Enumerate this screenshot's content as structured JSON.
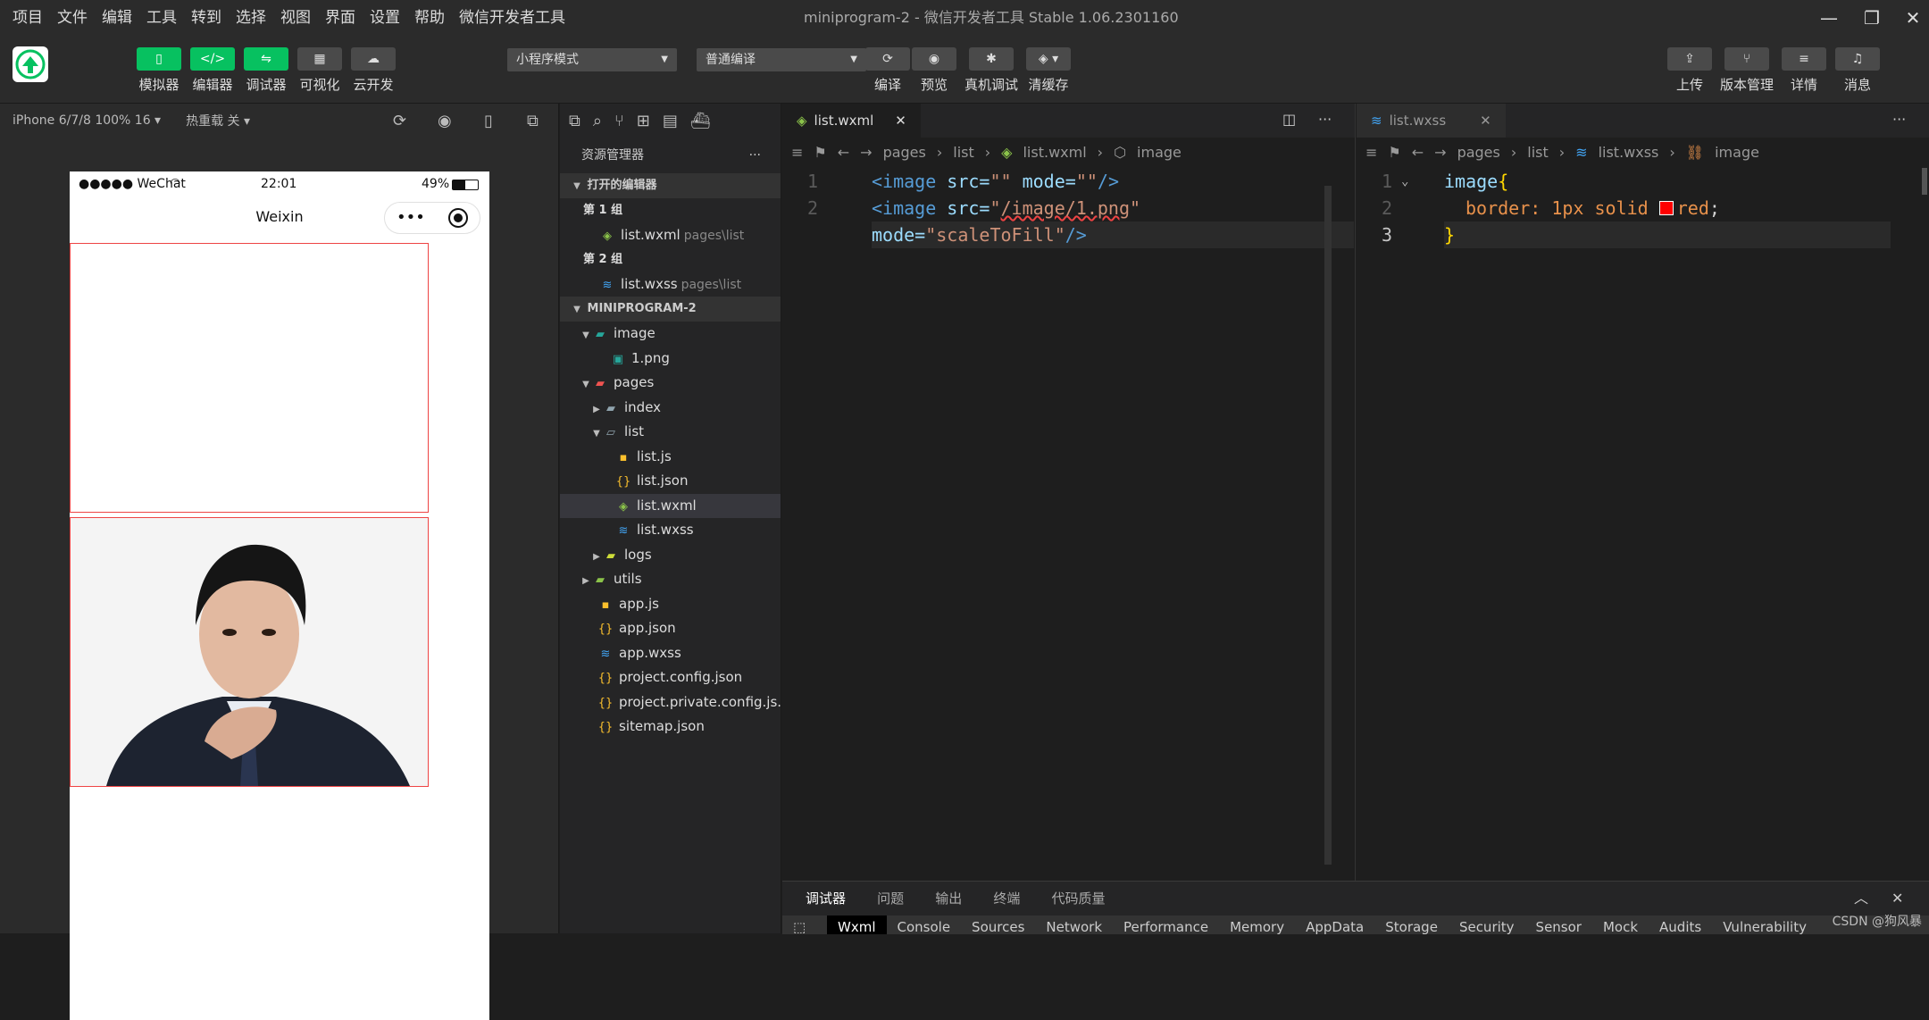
{
  "menubar": {
    "items": [
      "项目",
      "文件",
      "编辑",
      "工具",
      "转到",
      "选择",
      "视图",
      "界面",
      "设置",
      "帮助",
      "微信开发者工具"
    ],
    "title": "miniprogram-2 - 微信开发者工具 Stable 1.06.2301160"
  },
  "toolbar": {
    "left_buttons": [
      "模拟器",
      "编辑器",
      "调试器",
      "可视化",
      "云开发"
    ],
    "mode_select": "小程序模式",
    "compile_select": "普通编译",
    "mid_buttons": [
      "编译",
      "预览",
      "真机调试",
      "清缓存"
    ],
    "right_buttons": [
      "上传",
      "版本管理",
      "详情",
      "消息"
    ]
  },
  "simulator": {
    "device": "iPhone 6/7/8 100% 16",
    "hot_reload": "热重载 关",
    "status": {
      "carrier": "●●●●● WeChat",
      "time": "22:01",
      "battery": "49%"
    },
    "nav_title": "Weixin",
    "capsule_dots": "•••"
  },
  "explorer": {
    "title": "资源管理器",
    "open_editors_section": "打开的编辑器",
    "group1": "第 1 组",
    "group1_file": "list.wxml",
    "group1_path": "pages\\list",
    "group2": "第 2 组",
    "group2_file": "list.wxss",
    "group2_path": "pages\\list",
    "project_section": "MINIPROGRAM-2",
    "tree": {
      "image": "image",
      "image_1": "1.png",
      "pages": "pages",
      "index": "index",
      "list": "list",
      "list_js": "list.js",
      "list_json": "list.json",
      "list_wxml": "list.wxml",
      "list_wxss": "list.wxss",
      "logs": "logs",
      "utils": "utils",
      "app_js": "app.js",
      "app_json": "app.json",
      "app_wxss": "app.wxss",
      "project_config": "project.config.json",
      "project_private": "project.private.config.js...",
      "sitemap": "sitemap.json"
    }
  },
  "editor1": {
    "tab": "list.wxml",
    "crumbs": [
      "pages",
      "list",
      "list.wxml",
      "image"
    ],
    "line_numbers": [
      "1",
      "2"
    ],
    "l1": {
      "open": "<image",
      "attr1": " src=",
      "v1": "\"\"",
      "attr2": " mode=",
      "v2": "\"\"",
      "close": "/>"
    },
    "l2a": {
      "open": "<image",
      "attr1": " src=",
      "q1": "\"",
      "v1": "/image/1.png",
      "q2": "\""
    },
    "l2b": {
      "attr": "mode=",
      "v": "\"scaleToFill\"",
      "close": "/>"
    }
  },
  "editor2": {
    "tab": "list.wxss",
    "crumbs": [
      "pages",
      "list",
      "list.wxss",
      "image"
    ],
    "line_numbers": [
      "1",
      "2",
      "3"
    ],
    "l1": {
      "sel": "image",
      "brace": "{"
    },
    "l2": {
      "prop": "border:",
      "val1": " 1px solid ",
      "val2": "red",
      "semi": ";"
    },
    "l3": {
      "brace": "}"
    }
  },
  "panel": {
    "tabs": [
      "调试器",
      "问题",
      "输出",
      "终端",
      "代码质量"
    ],
    "devtools_tabs": [
      "Wxml",
      "Console",
      "Sources",
      "Network",
      "Performance",
      "Memory",
      "AppData",
      "Storage",
      "Security",
      "Sensor",
      "Mock",
      "Audits",
      "Vulnerability"
    ]
  },
  "watermark": "CSDN @狗风暴",
  "colors": {
    "accent_green": "#07c160",
    "border_red": "#ee4444"
  }
}
